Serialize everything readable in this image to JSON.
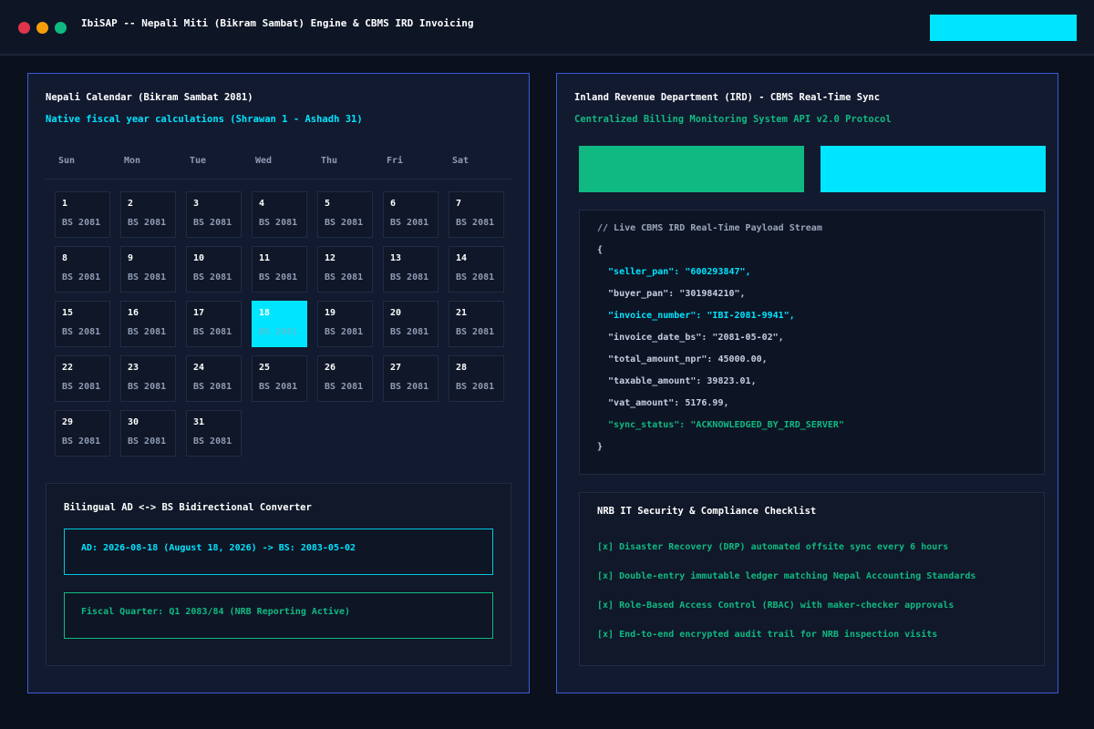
{
  "window": {
    "title": "IbiSAP -- Nepali Miti (Bikram Sambat) Engine & CBMS IRD Invoicing",
    "accent_color": "#00e5ff"
  },
  "calendar": {
    "title": "Nepali Calendar (Bikram Sambat 2081)",
    "subtitle": "Native fiscal year calculations (Shrawan 1 - Ashadh 31)",
    "weekdays": [
      "Sun",
      "Mon",
      "Tue",
      "Wed",
      "Thu",
      "Fri",
      "Sat"
    ],
    "year_label": "BS 2081",
    "selected_day": 18,
    "days": [
      "1",
      "2",
      "3",
      "4",
      "5",
      "6",
      "7",
      "8",
      "9",
      "10",
      "11",
      "12",
      "13",
      "14",
      "15",
      "16",
      "17",
      "18",
      "19",
      "20",
      "21",
      "22",
      "23",
      "24",
      "25",
      "26",
      "27",
      "28",
      "29",
      "30",
      "31"
    ]
  },
  "converter": {
    "title": "Bilingual AD <-> BS Bidirectional Converter",
    "conversion": "AD: 2026-08-18 (August 18, 2026) -> BS: 2083-05-02",
    "quarter": "Fiscal Quarter: Q1 2083/84 (NRB Reporting Active)"
  },
  "ird": {
    "title": "Inland Revenue Department (IRD) - CBMS Real-Time Sync",
    "subtitle": "Centralized Billing Monitoring System API v2.0 Protocol",
    "payload_lines": [
      "// Live CBMS IRD Real-Time Payload Stream",
      "{",
      "  \"seller_pan\": \"600293847\",",
      "  \"buyer_pan\": \"301984210\",",
      "  \"invoice_number\": \"IBI-2081-9941\",",
      "  \"invoice_date_bs\": \"2081-05-02\",",
      "  \"total_amount_npr\": 45000.00,",
      "  \"taxable_amount\": 39823.01,",
      "  \"vat_amount\": 5176.99,",
      "  \"sync_status\": \"ACKNOWLEDGED_BY_IRD_SERVER\"",
      "}"
    ],
    "line_styles": [
      "comment",
      "",
      "hl",
      "",
      "hl",
      "",
      "",
      "",
      "",
      "ok",
      ""
    ]
  },
  "compliance": {
    "title": "NRB IT Security & Compliance Checklist",
    "items": [
      "[x] Disaster Recovery (DRP) automated offsite sync every 6 hours",
      "[x] Double-entry immutable ledger matching Nepal Accounting Standards",
      "[x] Role-Based Access Control (RBAC) with maker-checker approvals",
      "[x] End-to-end encrypted audit trail for NRB inspection visits"
    ]
  }
}
